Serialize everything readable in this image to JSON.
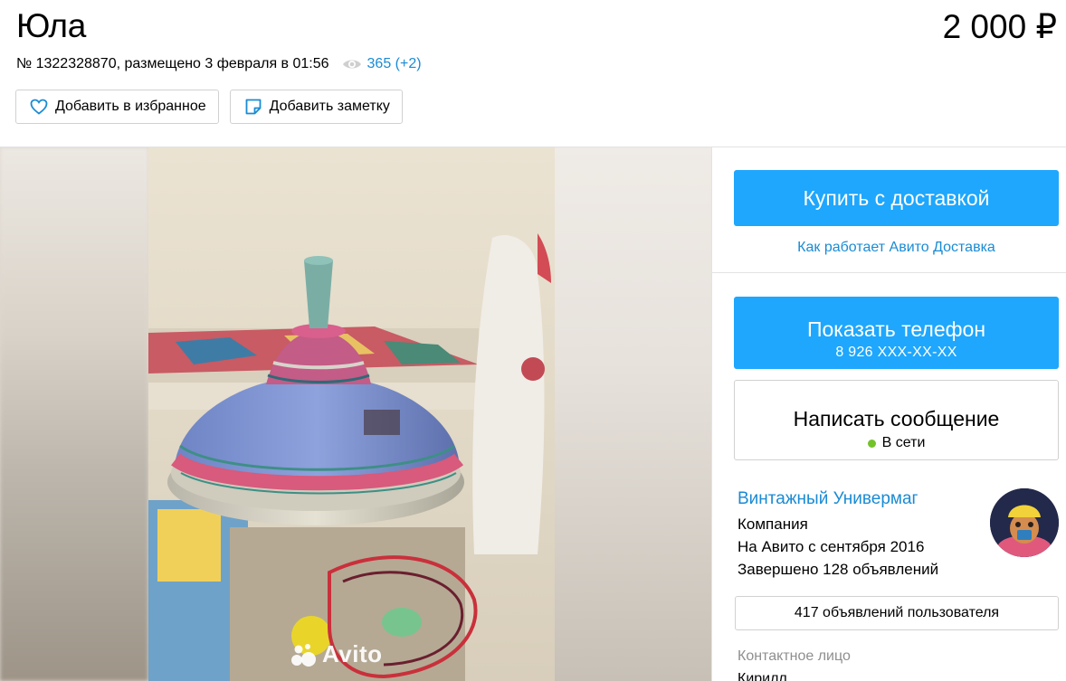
{
  "header": {
    "title": "Юла",
    "price": "2 000 ₽",
    "meta": "№ 1322328870, размещено 3 февраля в 01:56",
    "views": "365 (+2)",
    "favorite_label": "Добавить в избранное",
    "note_label": "Добавить заметку"
  },
  "gallery": {
    "watermark": "Avito"
  },
  "sidebar": {
    "buy_label": "Купить с доставкой",
    "delivery_link": "Как работает Авито Доставка",
    "phone_label": "Показать телефон",
    "phone_number": "8 926 XXX-XX-XX",
    "message_label": "Написать сообщение",
    "online_status": "В сети",
    "seller": {
      "name": "Винтажный Универмаг",
      "type": "Компания",
      "since": "На Авито с сентября 2016",
      "completed": "Завершено 128 объявлений"
    },
    "listings_label": "417 объявлений пользователя",
    "contact_label": "Контактное лицо",
    "contact_name": "Кирилл"
  },
  "colors": {
    "accent_blue": "#1ea7fd",
    "link_blue": "#1a8bd4",
    "online_green": "#73c22a"
  },
  "icons": [
    "eye-icon",
    "heart-icon",
    "note-icon",
    "avito-logo-icon"
  ]
}
